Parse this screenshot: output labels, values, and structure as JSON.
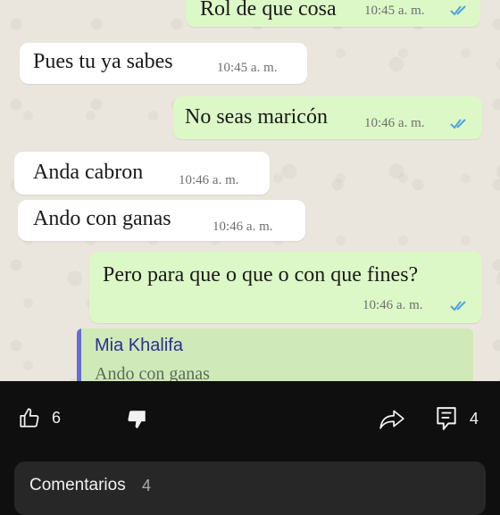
{
  "chat": {
    "messages": [
      {
        "direction": "out",
        "text": "Rol de que cosa",
        "time": "10:45 a. m.",
        "read": true
      },
      {
        "direction": "in",
        "text": "Pues tu ya sabes",
        "time": "10:45 a. m."
      },
      {
        "direction": "out",
        "text": "No seas maricón",
        "time": "10:46 a. m.",
        "read": true
      },
      {
        "direction": "in",
        "text": "Anda cabron",
        "time": "10:46 a. m."
      },
      {
        "direction": "in",
        "text": "Ando con ganas",
        "time": "10:46 a. m."
      },
      {
        "direction": "out",
        "text": "Pero para que o que o con que fines?",
        "time": "10:46 a. m.",
        "read": true
      }
    ],
    "quoted_reply": {
      "author": "Mia Khalifa",
      "text": "Ando con ganas"
    },
    "colors": {
      "incoming": "#ffffff",
      "outgoing": "#dcf8c6",
      "tick": "#4fa3e0"
    }
  },
  "actions": {
    "like_count": "6",
    "comments_count": "4",
    "icons": [
      "thumbs-up-icon",
      "thumbs-down-icon",
      "share-icon",
      "comments-icon"
    ]
  },
  "comments_panel": {
    "title": "Comentarios",
    "count": "4"
  }
}
